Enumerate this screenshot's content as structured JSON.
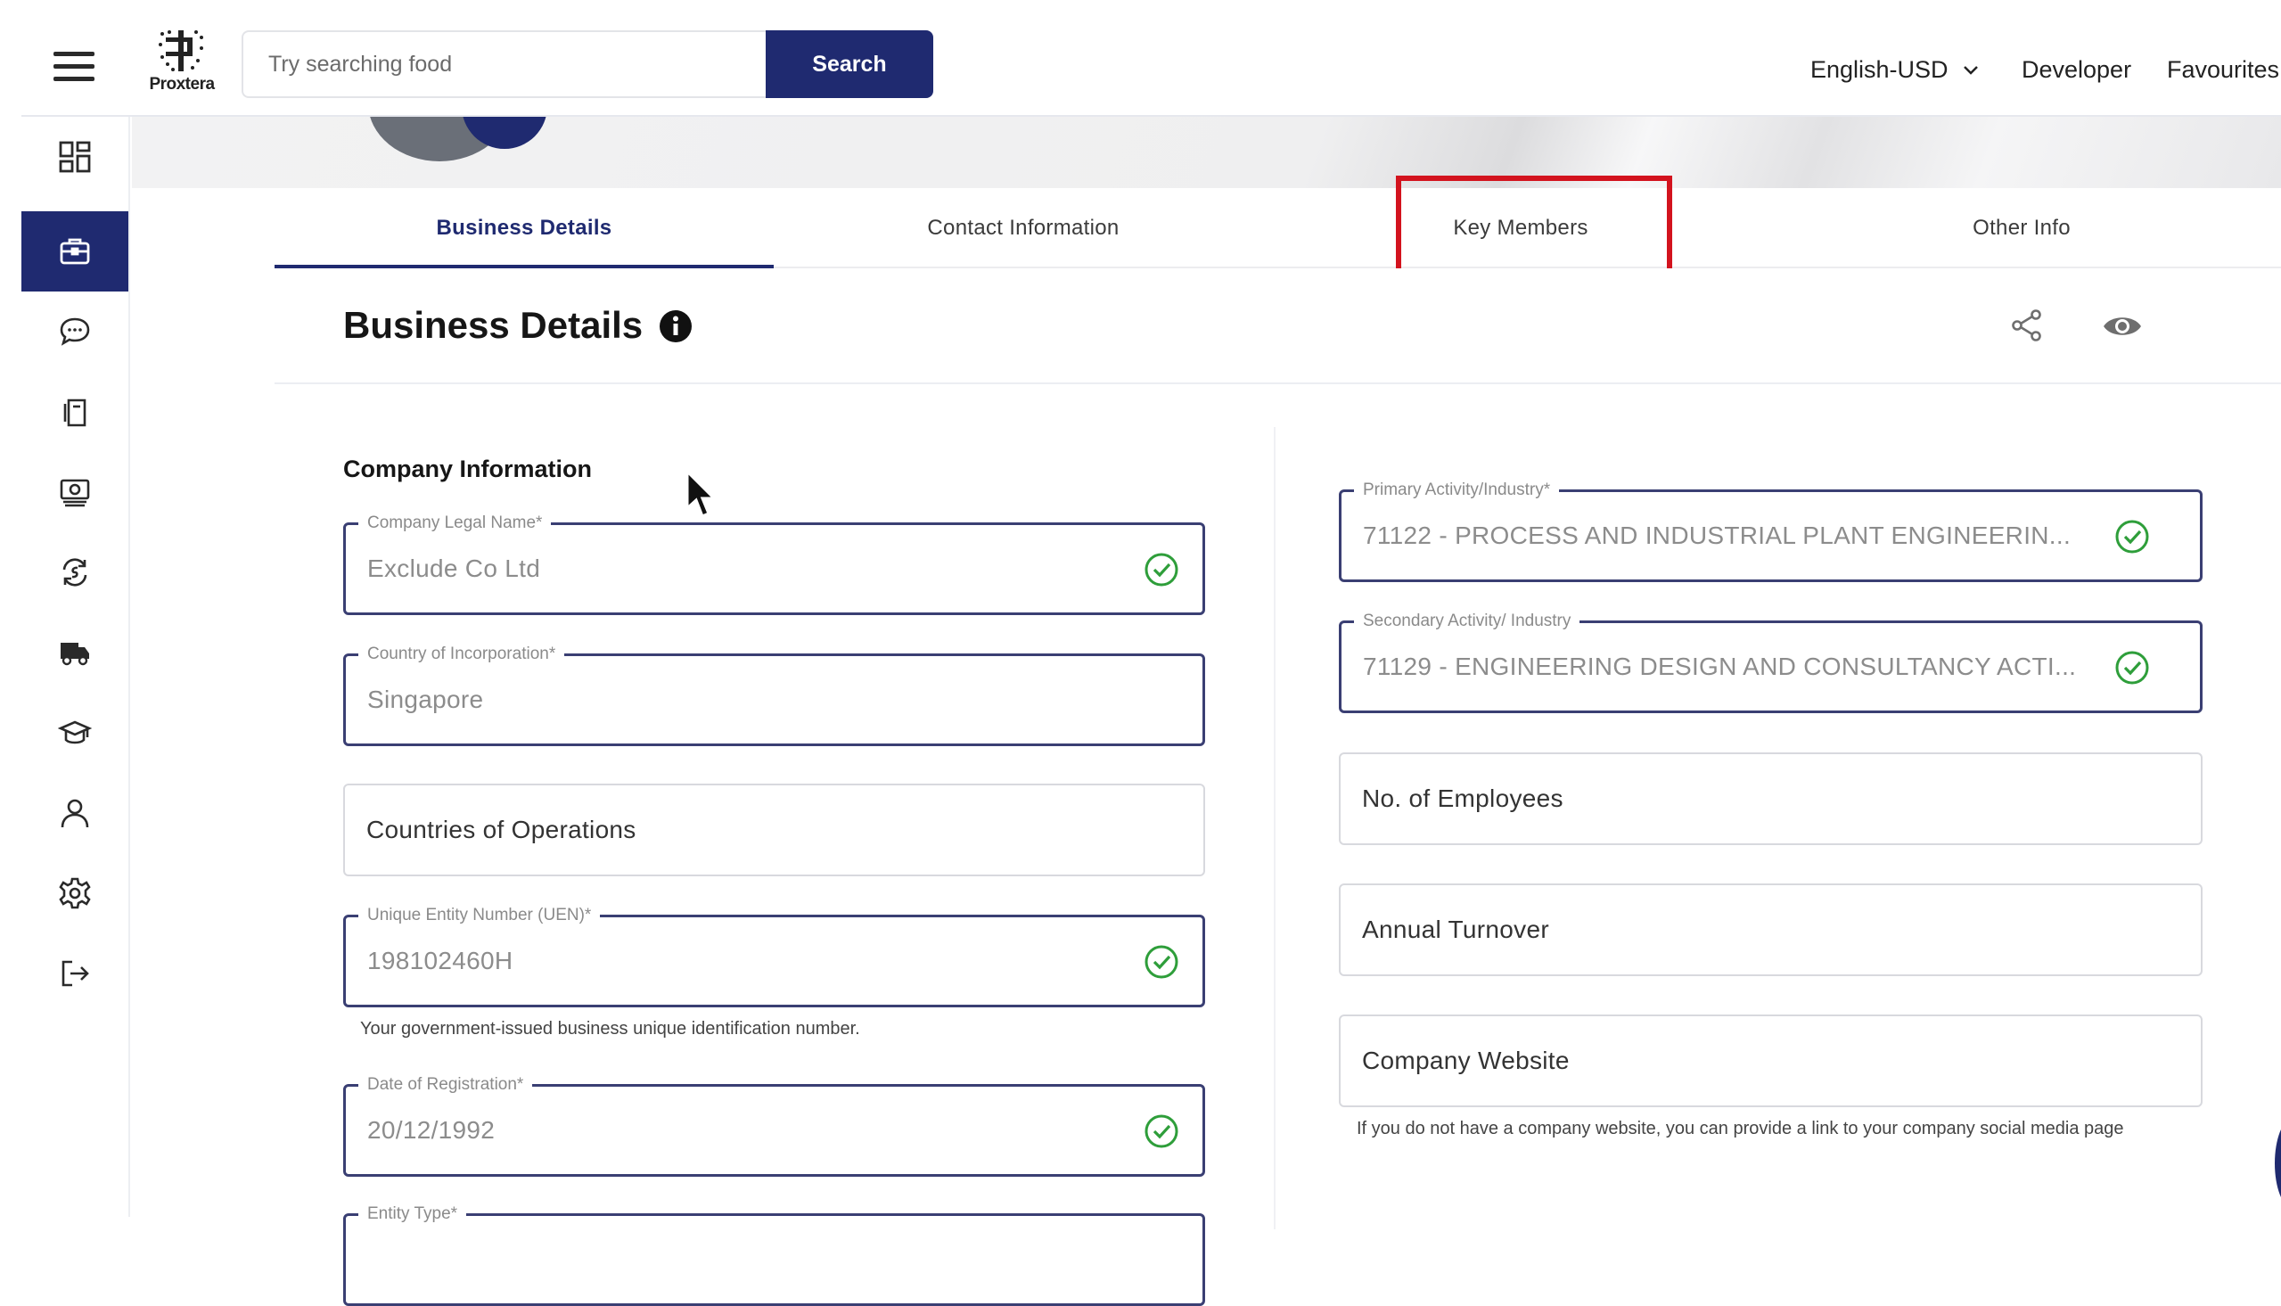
{
  "header": {
    "brand": "Proxtera",
    "search_placeholder": "Try searching food",
    "search_button": "Search",
    "language": "English-USD",
    "nav": [
      "Developer",
      "Favourites"
    ]
  },
  "sidebar": {
    "items": [
      {
        "icon": "dashboard-icon",
        "active": false
      },
      {
        "icon": "briefcase-icon",
        "active": true
      },
      {
        "icon": "chat-icon",
        "active": false
      },
      {
        "icon": "documents-icon",
        "active": false
      },
      {
        "icon": "money-icon",
        "active": false
      },
      {
        "icon": "exchange-icon",
        "active": false
      },
      {
        "icon": "truck-icon",
        "active": false
      },
      {
        "icon": "graduation-cap-icon",
        "active": false
      },
      {
        "icon": "user-icon",
        "active": false
      },
      {
        "icon": "settings-icon",
        "active": false
      },
      {
        "icon": "logout-icon",
        "active": false
      }
    ]
  },
  "tabs": [
    {
      "label": "Business Details",
      "active": true
    },
    {
      "label": "Contact Information",
      "active": false
    },
    {
      "label": "Key Members",
      "active": false,
      "highlighted": true
    },
    {
      "label": "Other Info",
      "active": false
    }
  ],
  "page": {
    "title": "Business Details",
    "group_title": "Company Information"
  },
  "left_fields": [
    {
      "label": "Company Legal Name*",
      "value": "Exclude Co Ltd",
      "valid": true
    },
    {
      "label": "Country of Incorporation*",
      "value": "Singapore",
      "valid": false
    },
    {
      "label": "",
      "placeholder": "Countries of Operations"
    },
    {
      "label": "Unique Entity Number (UEN)*",
      "value": "198102460H",
      "valid": true,
      "help": "Your government-issued business unique identification number."
    },
    {
      "label": "Date of Registration*",
      "value": "20/12/1992",
      "valid": true
    },
    {
      "label": "Entity Type*"
    }
  ],
  "right_fields": [
    {
      "label": "Primary Activity/Industry*",
      "value": "71122 - PROCESS AND INDUSTRIAL PLANT ENGINEERIN...",
      "valid": true
    },
    {
      "label": "Secondary Activity/ Industry",
      "value": "71129 - ENGINEERING DESIGN AND CONSULTANCY ACTI...",
      "valid": true
    },
    {
      "placeholder": "No. of Employees"
    },
    {
      "placeholder": "Annual Turnover"
    },
    {
      "placeholder": "Company Website",
      "help": "If you do not have a company website, you can provide a link to your company social media page"
    }
  ],
  "colors": {
    "brand": "#1f2a70",
    "highlight": "#d3131e",
    "valid": "#2e9e3a"
  }
}
